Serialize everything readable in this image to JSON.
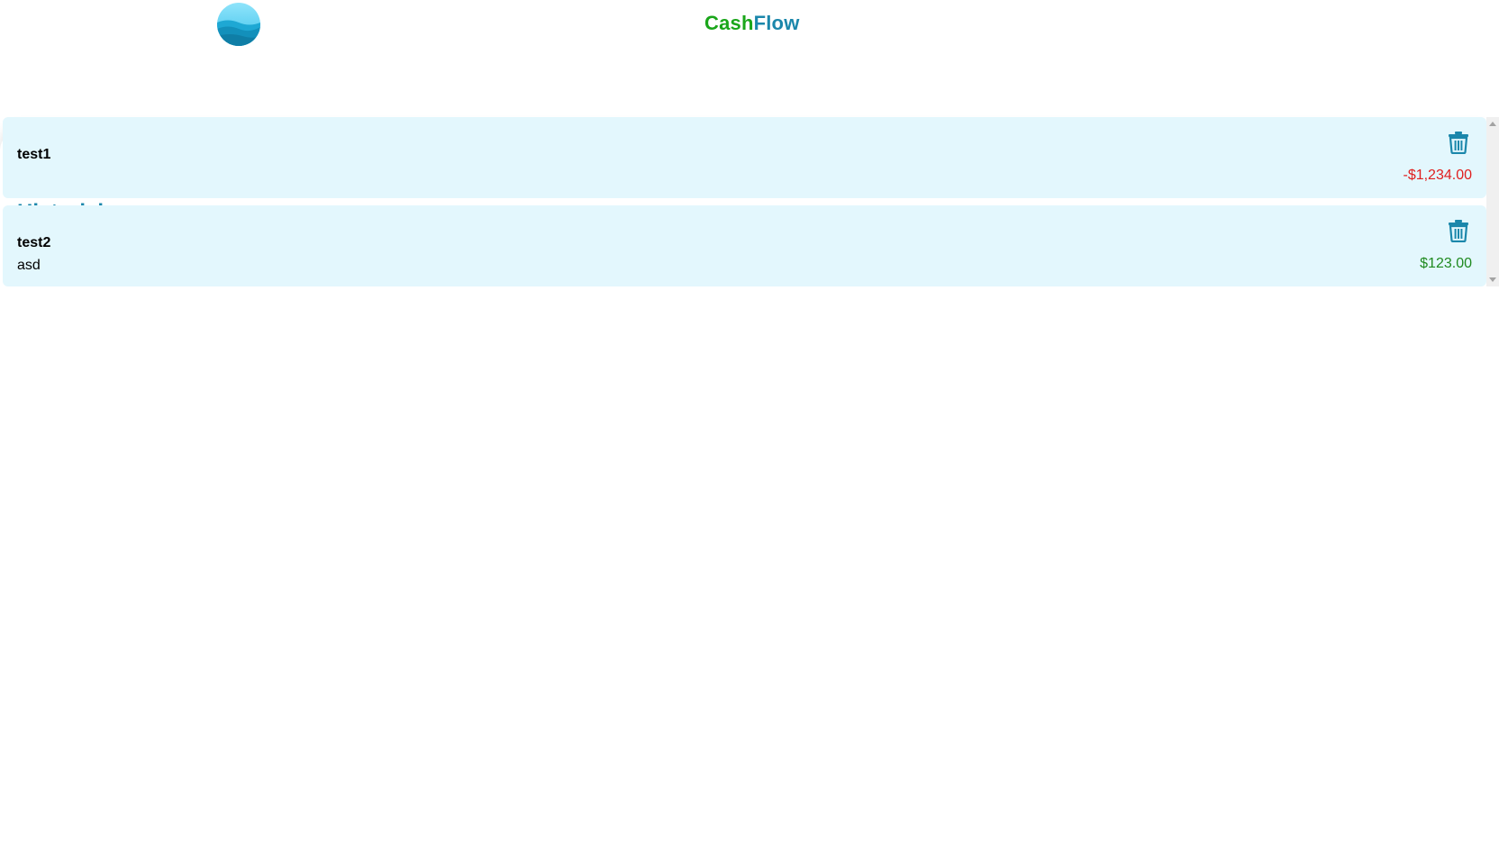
{
  "app": {
    "brand_part1": "Cash",
    "brand_part2": "Flow",
    "brand_color1": "#1aa61a",
    "brand_color2": "#1b87ab",
    "logo_icon": "ocean-wave-logo"
  },
  "history": {
    "title": "Historial",
    "items": [
      {
        "name": "test1",
        "description": "",
        "amount": "-$1,234.00",
        "amount_color": "#e01e1e",
        "delete_icon": "trash-icon"
      },
      {
        "name": "test2",
        "description": "asd",
        "amount": "$123.00",
        "amount_color": "#1f8a1f",
        "delete_icon": "trash-icon"
      }
    ]
  },
  "colors": {
    "accent": "#1b87ab",
    "row_background": "#e3f7fd"
  }
}
